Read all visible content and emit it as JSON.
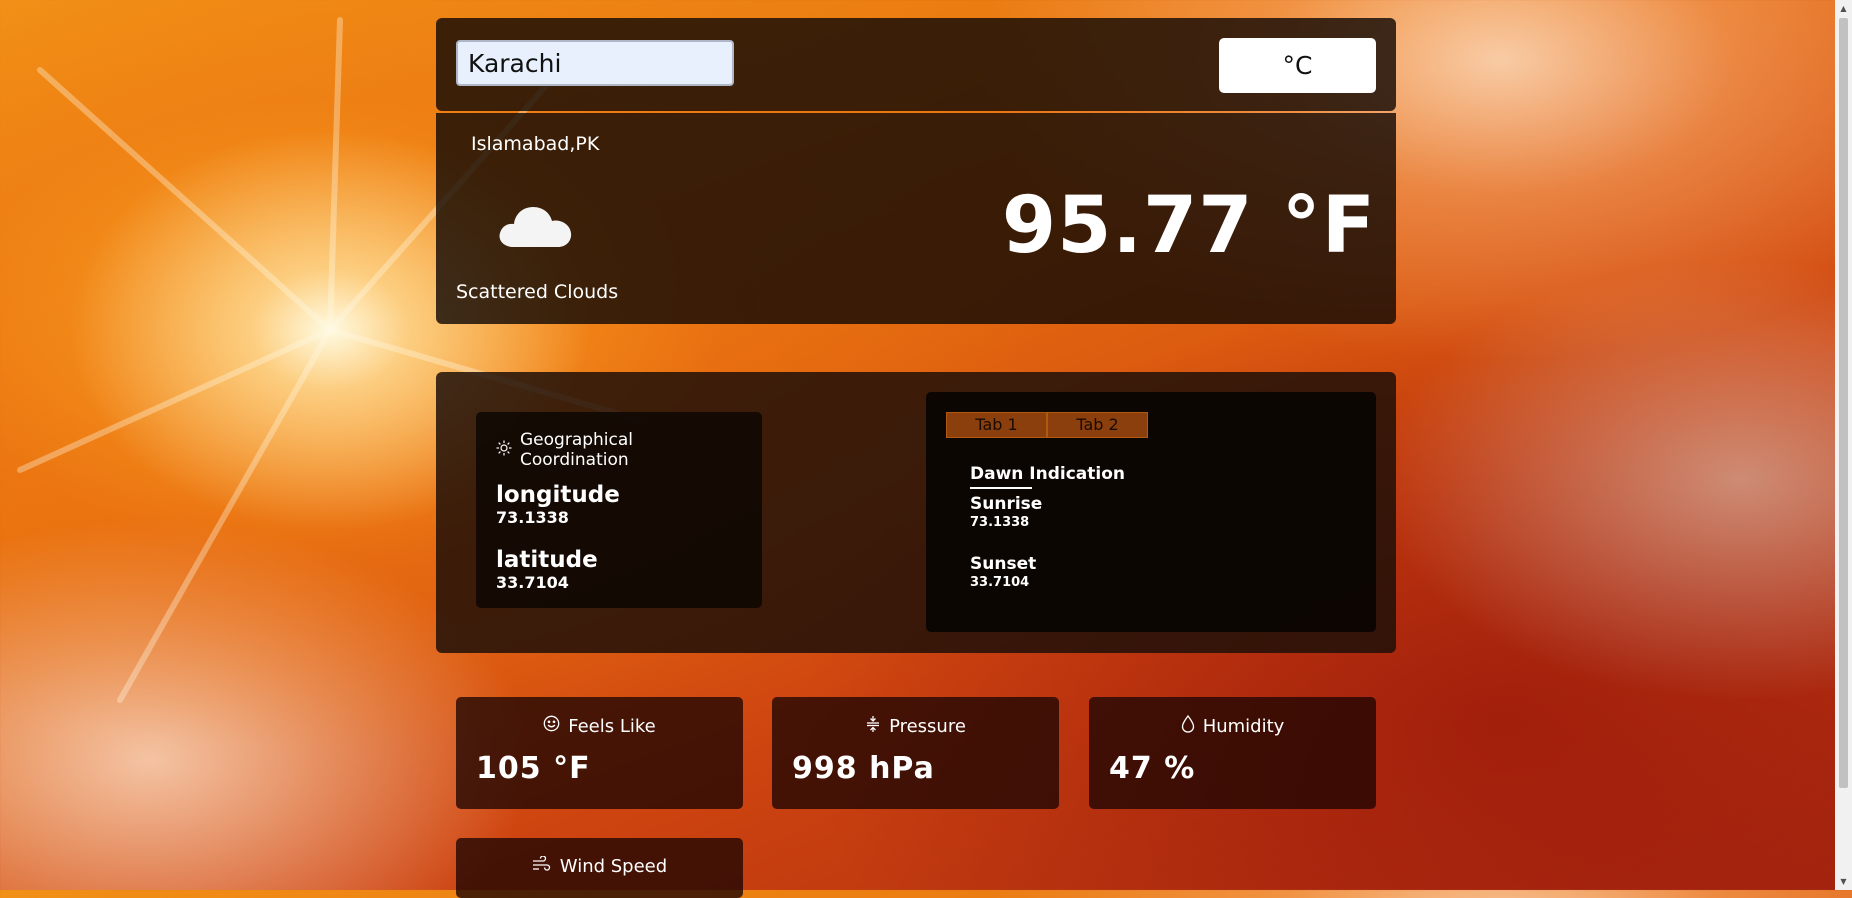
{
  "search": {
    "value": "Karachi"
  },
  "unit_toggle": {
    "label": "°C"
  },
  "current": {
    "city": "Islamabad,PK",
    "icon": "cloud-icon",
    "description": "Scattered Clouds",
    "temperature": "95.77 °F"
  },
  "geo": {
    "header": "Geographical Coordination",
    "icon": "sun-icon",
    "longitude_label": "longitude",
    "longitude_value": "73.1338",
    "latitude_label": "latitude",
    "latitude_value": "33.7104"
  },
  "tabs": {
    "items": [
      {
        "label": "Tab 1"
      },
      {
        "label": "Tab 2"
      }
    ],
    "title": "Dawn Indication",
    "sunrise_label": "Sunrise",
    "sunrise_value": "73.1338",
    "sunset_label": "Sunset",
    "sunset_value": "33.7104",
    "tab_color": "#8a3f0c"
  },
  "stats": [
    {
      "label": "Feels Like",
      "icon": "smiley-icon",
      "value": "105 °F"
    },
    {
      "label": "Pressure",
      "icon": "pressure-icon",
      "value": "998 hPa"
    },
    {
      "label": "Humidity",
      "icon": "droplet-icon",
      "value": "47 %"
    },
    {
      "label": "Wind Speed",
      "icon": "wind-icon",
      "value": ""
    }
  ]
}
